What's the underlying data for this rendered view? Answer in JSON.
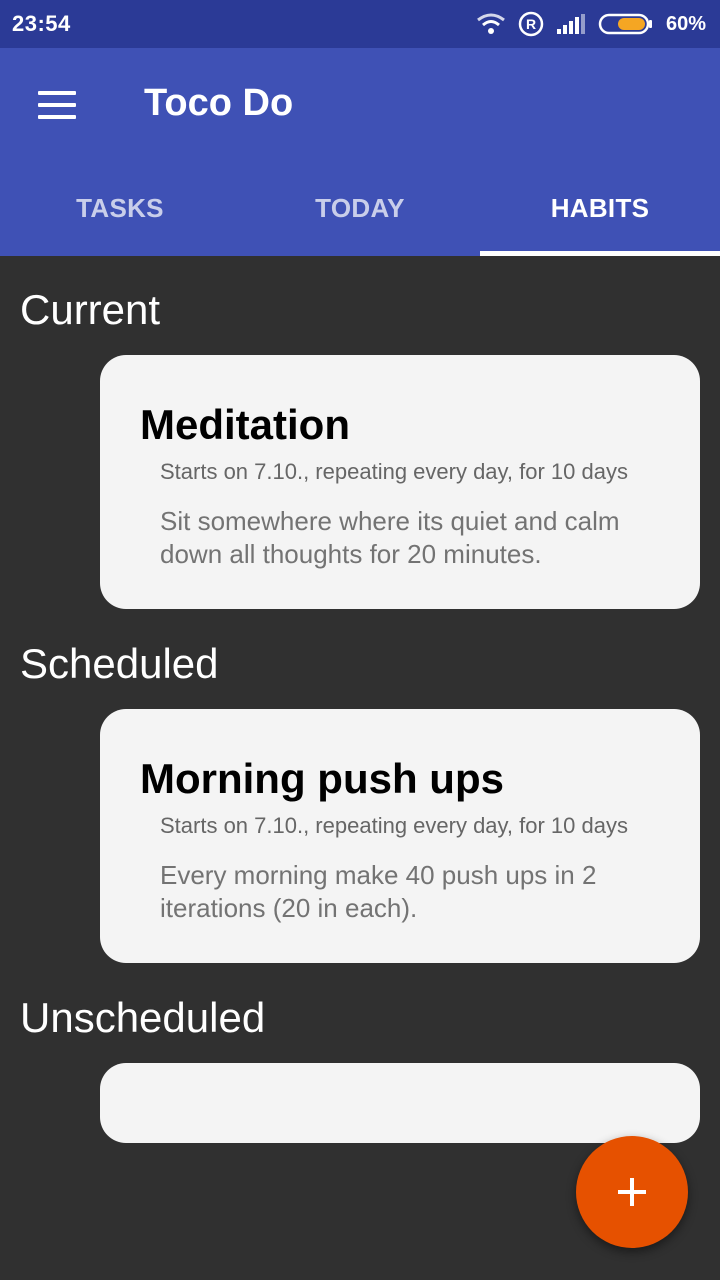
{
  "status_bar": {
    "time": "23:54",
    "battery_percent": "60%",
    "icons": [
      "wifi-icon",
      "registered-icon",
      "signal-icon",
      "battery-icon"
    ]
  },
  "app_bar": {
    "title": "Toco Do",
    "menu_icon": "hamburger-menu-icon",
    "color": "#3f51b5"
  },
  "tabs": [
    {
      "label": "TASKS",
      "active": false
    },
    {
      "label": "TODAY",
      "active": false
    },
    {
      "label": "HABITS",
      "active": true
    }
  ],
  "sections": {
    "current": {
      "title": "Current",
      "cards": [
        {
          "title": "Meditation",
          "subtitle": "Starts on 7.10., repeating every day, for 10 days",
          "description": "Sit somewhere where its quiet and calm down all thoughts for 20 minutes."
        }
      ]
    },
    "scheduled": {
      "title": "Scheduled",
      "cards": [
        {
          "title": "Morning push ups",
          "subtitle": "Starts on 7.10., repeating every day, for 10 days",
          "description": "Every morning make 40 push ups in 2 iterations (20 in each)."
        }
      ]
    },
    "unscheduled": {
      "title": "Unscheduled"
    }
  },
  "fab": {
    "icon": "plus-icon",
    "color": "#e65100"
  }
}
